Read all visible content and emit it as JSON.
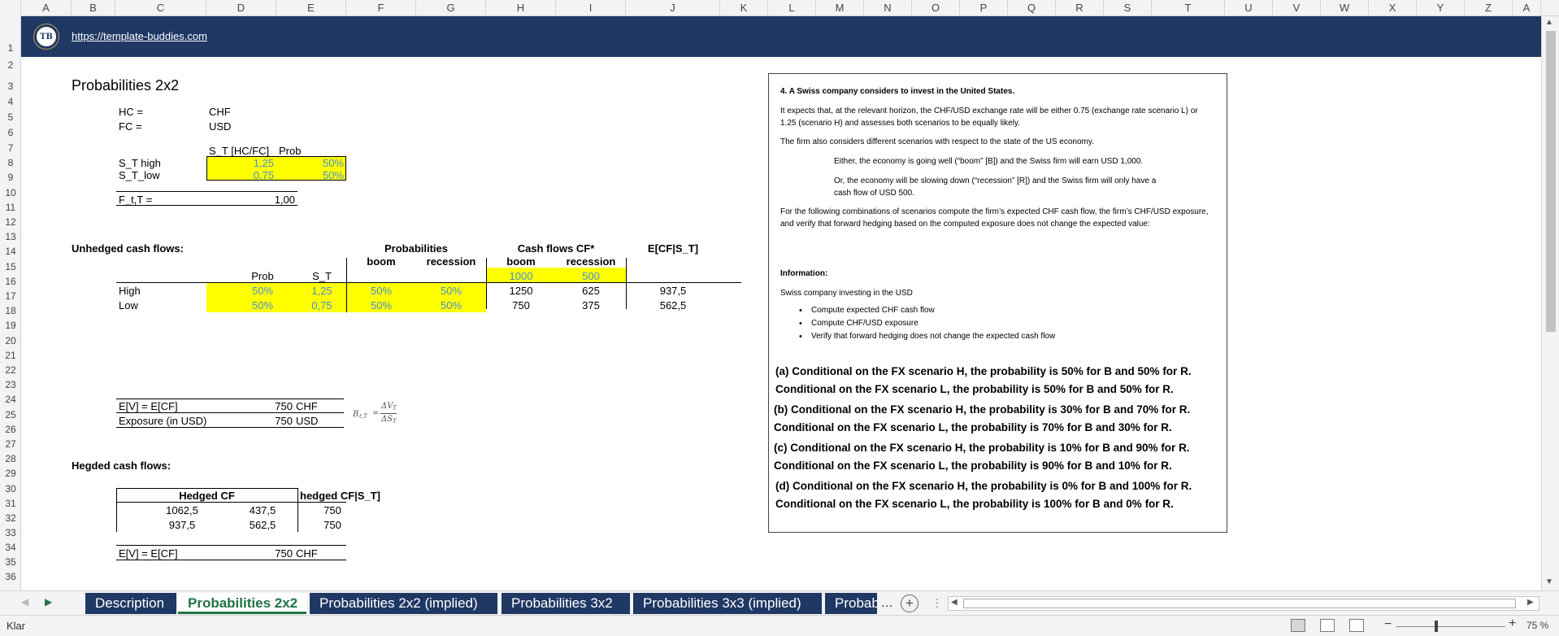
{
  "columns": [
    "A",
    "B",
    "C",
    "D",
    "E",
    "F",
    "G",
    "H",
    "I",
    "J",
    "K",
    "L",
    "M",
    "N",
    "O",
    "P",
    "Q",
    "R",
    "S",
    "T",
    "U",
    "V",
    "W",
    "X",
    "Y",
    "Z",
    "A"
  ],
  "rows": [
    "1",
    "2",
    "3",
    "4",
    "5",
    "6",
    "7",
    "8",
    "9",
    "10",
    "11",
    "12",
    "13",
    "14",
    "15",
    "16",
    "17",
    "18",
    "19",
    "20",
    "21",
    "22",
    "23",
    "24",
    "25",
    "26",
    "27",
    "28",
    "29",
    "30",
    "31",
    "32",
    "33",
    "34",
    "35",
    "36"
  ],
  "banner": {
    "logo_text": "TB",
    "url": "https://template-buddies.com"
  },
  "sheet": {
    "title": "Probabilities 2x2",
    "hc_label": "HC =",
    "hc_value": "CHF",
    "fc_label": "FC =",
    "fc_value": "USD",
    "st_header": "S_T [HC/FC]",
    "prob_header": "Prob",
    "st_high_label": "S_T high",
    "st_high_value": "1,25",
    "st_high_prob": "50%",
    "st_low_label": "S_T_low",
    "st_low_value": "0,75",
    "st_low_prob": "50%",
    "forward_label": "F_t,T =",
    "forward_value": "1,00",
    "unhedged_title": "Unhedged cash flows:",
    "probabilities_header": "Probabilities",
    "cashflows_header": "Cash flows CF*",
    "ecf_header": "E[CF|S_T]",
    "boom": "boom",
    "recession": "recession",
    "prob_col": "Prob",
    "st_col": "S_T",
    "cf_boom": "1000",
    "cf_recession": "500",
    "rows": [
      {
        "label": "High",
        "prob": "50%",
        "st": "1,25",
        "p_boom": "50%",
        "p_rec": "50%",
        "cf_boom": "1250",
        "cf_rec": "625",
        "ecf": "937,5"
      },
      {
        "label": "Low",
        "prob": "50%",
        "st": "0,75",
        "p_boom": "50%",
        "p_rec": "50%",
        "cf_boom": "750",
        "cf_rec": "375",
        "ecf": "562,5"
      }
    ],
    "ev_label": "E[V] = E[CF]",
    "ev_value": "750",
    "ev_unit": "CHF",
    "exposure_label": "Exposure (in USD)",
    "exposure_value": "750",
    "exposure_unit": "USD",
    "formula_b": "B",
    "formula_b_sub": "t,T",
    "formula_eq": "=",
    "formula_num": "ΔV",
    "formula_num_sub": "T",
    "formula_den": "ΔS",
    "formula_den_sub": "T",
    "hedged_title": "Hegded cash flows:",
    "hedged_cf_header": "Hedged CF",
    "hedged_cond_header": "hedged CF|S_T]",
    "hedged_rows": [
      {
        "a": "1062,5",
        "b": "437,5",
        "c": "750"
      },
      {
        "a": "937,5",
        "b": "562,5",
        "c": "750"
      }
    ],
    "ev2_label": "E[V] = E[CF]",
    "ev2_value": "750",
    "ev2_unit": "CHF"
  },
  "textbox": {
    "heading": "4. A Swiss company considers to invest in the United States.",
    "p1": "It expects that, at the relevant horizon, the CHF/USD exchange rate will be either 0.75 (exchange rate scenario L) or 1.25 (scenario H) and assesses both scenarios to be equally likely.",
    "p2": "The firm also considers different scenarios with respect to the state of the US economy.",
    "p3": "Either, the economy is going well (“boom” [B]) and the Swiss firm will earn USD 1,000.",
    "p4": "Or, the economy will be slowing down (“recession” [R]) and the Swiss firm will only have a cash flow of USD 500.",
    "p5": "For the following combinations of scenarios compute the firm’s expected CHF cash flow, the firm’s CHF/USD exposure, and verify that forward hedging based on the computed exposure does not change the expected value:",
    "info_heading": "Information:",
    "info_text": "Swiss company investing in the USD",
    "bullets": [
      "Compute expected CHF cash flow",
      "Compute CHF/USD exposure",
      "Verify that forward hedging does not change the expected cash flow"
    ],
    "a1": "(a) Conditional on the FX scenario H, the probability is 50% for B and 50% for R.",
    "a2": "Conditional on the FX scenario L, the probability is 50% for B and 50% for R.",
    "b1": "(b) Conditional on the FX scenario H, the probability is 30% for B and 70% for R.",
    "b2": "Conditional on the FX scenario L, the probability is 70% for B and 30% for R.",
    "c1": "(c) Conditional on the FX scenario H, the probability is 10% for B and 90% for R.",
    "c2": "Conditional on the FX scenario L, the probability is 90% for B and 10% for R.",
    "d1": "(d) Conditional on the FX scenario H, the probability is 0% for B and 100% for R.",
    "d2": "Conditional on the FX scenario L, the probability is 100% for B and 0% for R."
  },
  "tabs": [
    "Description",
    "Probabilities 2x2",
    "Probabilities 2x2 (implied)",
    "Probabilities 3x2",
    "Probabilities 3x3 (implied)",
    "Probab"
  ],
  "active_tab": "Probabilities 2x2",
  "tab_more": "...",
  "status": {
    "text": "Klar",
    "zoom": "75 %"
  }
}
